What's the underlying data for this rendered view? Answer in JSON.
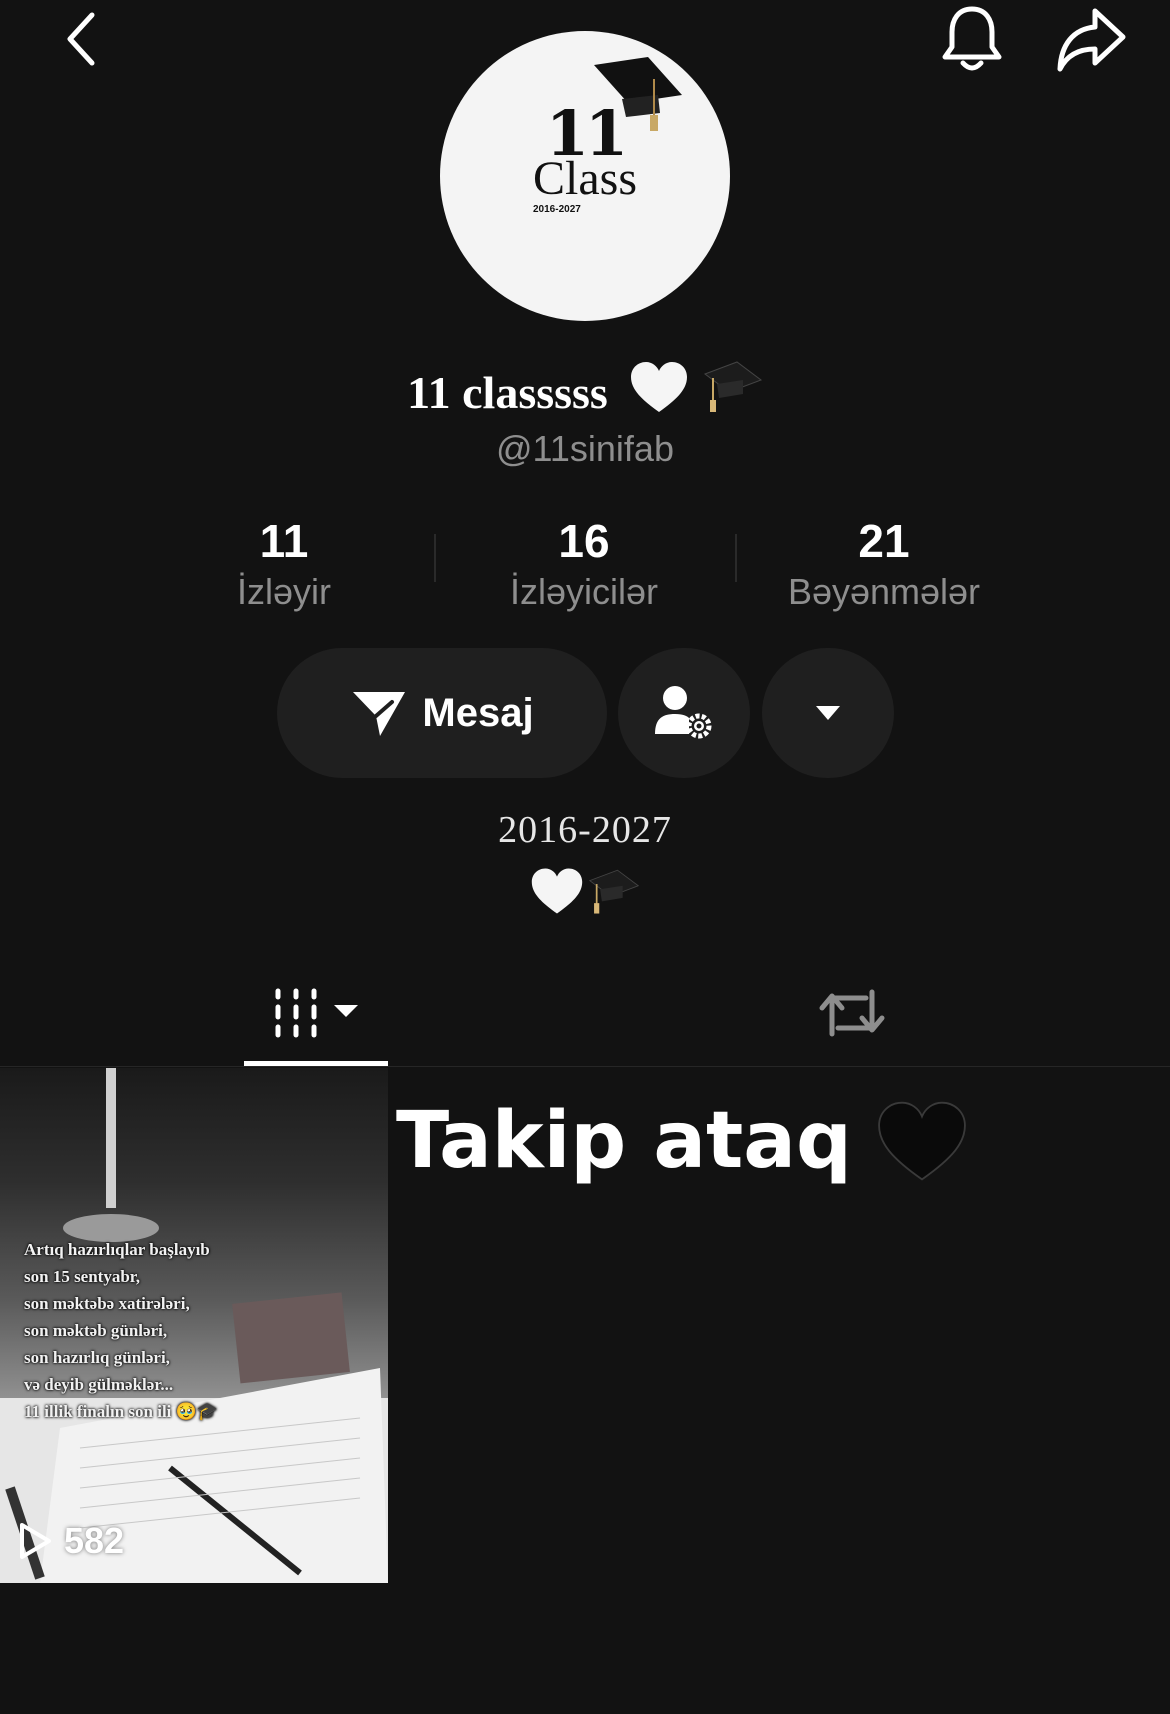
{
  "header": {
    "back_icon": "chevron-left-icon",
    "bell_icon": "bell-icon",
    "share_icon": "share-arrow-icon"
  },
  "avatar": {
    "logo_number": "11",
    "logo_word": "Class",
    "logo_years": "2016-2027"
  },
  "profile": {
    "display_name": "11 classsss",
    "username": "@11sinifab"
  },
  "stats": [
    {
      "value": "11",
      "label": "İzləyir"
    },
    {
      "value": "16",
      "label": "İzləyicilər"
    },
    {
      "value": "21",
      "label": "Bəyənmələr"
    }
  ],
  "actions": {
    "message_label": "Mesaj",
    "message_icon": "send-icon",
    "friend_settings_icon": "person-gear-icon",
    "more_icon": "caret-down-icon"
  },
  "bio": {
    "years": "2016-2027"
  },
  "tabs": [
    {
      "name": "videos",
      "icon": "grid-columns-icon",
      "active": true
    },
    {
      "name": "reposts",
      "icon": "repost-icon",
      "active": false
    }
  ],
  "videos": [
    {
      "caption": "Artıq hazırlıqlar başlayıb\nson 15 sentyabr,\nson məktəbə xatirələri,\nson məktəb günləri,\nson hazırlıq günləri,\nvə deyib gülməklər...\n11 illik finalın son ili 🥹🎓",
      "views": "582"
    }
  ],
  "promo": {
    "text": "Takip ataq"
  },
  "colors": {
    "background": "#121212",
    "button_bg": "#1f1f1f",
    "muted_text": "#8e8e8e"
  }
}
